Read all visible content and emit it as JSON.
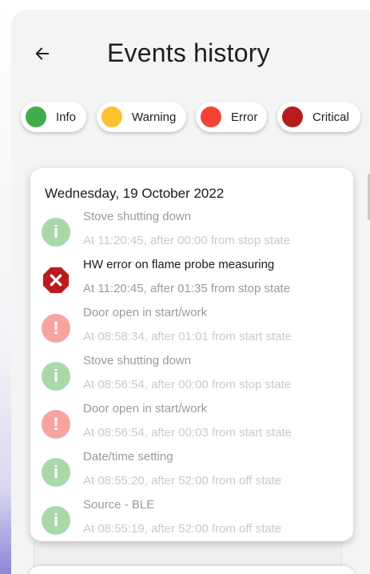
{
  "header": {
    "title": "Events history",
    "back_icon": "arrow-left-icon"
  },
  "filters": [
    {
      "label": "Info",
      "color": "#3fae4a"
    },
    {
      "label": "Warning",
      "color": "#fbc02d"
    },
    {
      "label": "Error",
      "color": "#f44336"
    },
    {
      "label": "Critical",
      "color": "#b71c1c"
    }
  ],
  "day": {
    "date": "Wednesday, 19 October 2022",
    "events": [
      {
        "title": "Stove shutting down",
        "detail": "At 11:20:45, after 00:00 from stop state",
        "level": "info",
        "icon": "info-icon",
        "faded": true
      },
      {
        "title": "HW error on flame probe measuring",
        "detail": "At 11:20:45, after 01:35 from stop state",
        "level": "critical",
        "icon": "critical-error-icon",
        "faded": false
      },
      {
        "title": "Door open in start/work",
        "detail": "At 08:58:34, after 01:01 from start state",
        "level": "error",
        "icon": "error-icon",
        "faded": true
      },
      {
        "title": "Stove shutting down",
        "detail": "At 08:56:54, after 00:00 from stop state",
        "level": "info",
        "icon": "info-icon",
        "faded": true
      },
      {
        "title": "Door open in start/work",
        "detail": "At 08:56:54, after 00:03 from start state",
        "level": "error",
        "icon": "error-icon",
        "faded": true
      },
      {
        "title": "Date/time setting",
        "detail": "At 08:55:20, after 52:00 from off state",
        "level": "info",
        "icon": "info-icon",
        "faded": true
      },
      {
        "title": "Source - BLE",
        "detail": "At 08:55:19, after 52:00 from off state",
        "level": "info",
        "icon": "info-icon",
        "faded": true
      }
    ]
  },
  "colors": {
    "info_faded": "#a8d9a9",
    "error_faded": "#f6a4a0",
    "critical": "#b71c1c",
    "text_dark": "#1b1b1b",
    "text_muted": "#9a9a9a",
    "text_faint": "#c9c9c9"
  }
}
